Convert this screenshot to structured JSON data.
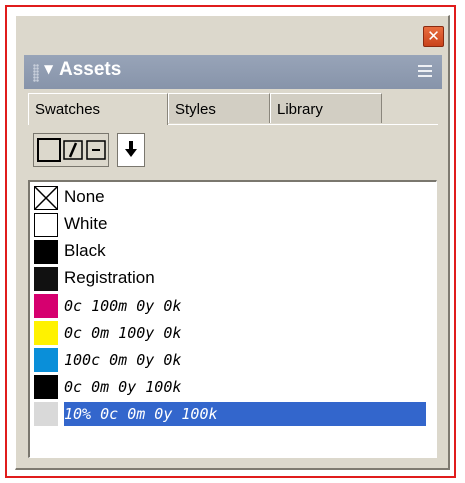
{
  "panel": {
    "title": "Assets",
    "close_glyph": "✕",
    "collapse_glyph": "▼",
    "tabs": [
      {
        "label": "Swatches",
        "active": true
      },
      {
        "label": "Styles",
        "active": false
      },
      {
        "label": "Library",
        "active": false
      }
    ]
  },
  "toolbar": {
    "buttons": [
      "fill-box-icon",
      "stroke-icon",
      "container-icon",
      "arrow-down-icon"
    ],
    "arrow_glyph": "🠗"
  },
  "swatches": [
    {
      "label": "None",
      "color": "none",
      "italic": false
    },
    {
      "label": "White",
      "color": "#ffffff",
      "italic": false
    },
    {
      "label": "Black",
      "color": "#000000",
      "italic": false
    },
    {
      "label": "Registration",
      "color": "#111111",
      "italic": false
    },
    {
      "label": "0c 100m 0y 0k",
      "color": "#d6006f",
      "italic": true
    },
    {
      "label": "0c 0m 100y 0k",
      "color": "#fff200",
      "italic": true
    },
    {
      "label": "100c 0m 0y 0k",
      "color": "#0a8fd9",
      "italic": true
    },
    {
      "label": "0c 0m 0y 100k",
      "color": "#000000",
      "italic": true
    },
    {
      "label": "10% 0c 0m 0y 100k",
      "color": "#d9d9d9",
      "italic": true,
      "selected": true
    }
  ],
  "colors": {
    "frame": "#e01c1c",
    "title_bar": "#8794aa",
    "selection": "#3366cc"
  }
}
